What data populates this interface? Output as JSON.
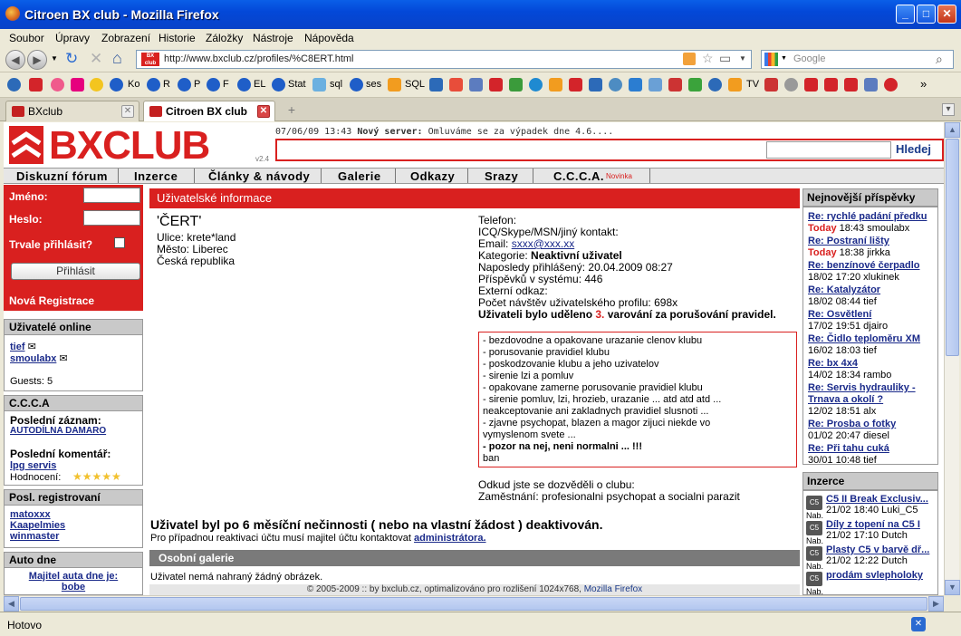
{
  "window": {
    "title": "Citroen BX club - Mozilla Firefox"
  },
  "menu": [
    "Soubor",
    "Úpravy",
    "Zobrazení",
    "Historie",
    "Záložky",
    "Nástroje",
    "Nápověda"
  ],
  "nav": {
    "url": "http://www.bxclub.cz/profiles/%C8ERT.html",
    "search_placeholder": "Google"
  },
  "bookmarks": [
    "Ko",
    "R",
    "P",
    "F",
    "EL",
    "Stat",
    "sql",
    "ses",
    "SQL",
    "TV"
  ],
  "tabs": [
    {
      "label": "BXclub"
    },
    {
      "label": "Citroen BX club"
    }
  ],
  "site": {
    "logo": "BXCLUB",
    "version": "v2.4",
    "news_date": "07/06/09 13:43",
    "news_title": "Nový server:",
    "news_text": "Omluváme se za výpadek dne 4.6....",
    "search_button": "Hledej",
    "nav": [
      "Diskuzní fórum",
      "Inzerce",
      "Články & návody",
      "Galerie",
      "Odkazy",
      "Srazy",
      "C.C.C.A."
    ],
    "nav_badge": "Novinka"
  },
  "login": {
    "name_label": "Jméno:",
    "pass_label": "Heslo:",
    "remember_label": "Trvale přihlásit?",
    "login_button": "Přihlásit",
    "register": "Nová Registrace"
  },
  "online": {
    "title": "Uživatelé online",
    "users": [
      "tief",
      "smoulabx"
    ],
    "guests": "Guests: 5"
  },
  "ccca": {
    "title": "C.C.C.A",
    "last_record_label": "Poslední záznam:",
    "last_record": "AUTODÍLNA DAMARO",
    "last_comment_label": "Poslední komentář:",
    "last_comment": "lpg servis",
    "rating_label": "Hodnocení:",
    "rating_stars": 5
  },
  "registered": {
    "title": "Posl. registrovaní",
    "users": [
      "matoxxx",
      "Kaapelmies",
      "winmaster"
    ]
  },
  "carday": {
    "title": "Auto dne",
    "owner_label": "Majitel auta dne je:",
    "owner": "bobe"
  },
  "profile": {
    "section_title": "Uživatelské informace",
    "name": "'ČERT'",
    "street": "Ulice: krete*land",
    "city": "Město: Liberec",
    "country": "Česká republika",
    "phone": "Telefon:",
    "icq": "ICQ/Skype/MSN/jiný kontakt:",
    "email_label": "Email:",
    "email": "sxxx@xxx.xx",
    "category_label": "Kategorie:",
    "category": "Neaktivní uživatel",
    "last_login": "Naposledy přihlášený: 20.04.2009 08:27",
    "posts": "Příspěvků v systému: 446",
    "external": "Externí odkaz:",
    "visits": "Počet návštěv uživatelského profilu: 698x",
    "warn_prefix": "Uživateli bylo uděleno",
    "warn_count": "3.",
    "warn_suffix": "varování za porušování pravidel.",
    "rules": [
      "- bezdovodne a opakovane urazanie clenov klubu",
      "- porusovanie pravidiel klubu",
      "- poskodzovanie klubu a jeho uzivatelov",
      "- sirenie lzi a pomluv",
      "- opakovane zamerne porusovanie pravidiel klubu",
      "- sirenie pomluv, lzi, hrozieb, urazanie ... atd atd atd ...",
      "neakceptovanie ani zakladnych pravidiel slusnoti ...",
      "- zjavne psychopat, blazen a magor zijuci niekde vo",
      "vymyslenom svete ..."
    ],
    "rules_bold": "- pozor na nej, neni normalni ... !!!",
    "rules_end": "ban",
    "source": "Odkud jste se dozvěděli o clubu:",
    "job": "Zaměstnání: profesionalni psychopat a socialni parazit",
    "deactivated": "Uživatel byl po 6 měsíční nečinnosti ( nebo na vlastní žádost ) deaktivován.",
    "reactivation": "Pro případnou reaktivaci účtu musí majitel účtu kontaktovat",
    "admin_link": "administrátora.",
    "gallery_title": "Osobní galerie",
    "gallery_empty": "Uživatel nemá nahraný žádný obrázek."
  },
  "footer": {
    "text": "© 2005-2009 :: by bxclub.cz, optimalizováno pro rozlišení 1024x768,",
    "link": "Mozilla Firefox"
  },
  "latest": {
    "title": "Nejnovější příspěvky",
    "items": [
      {
        "title": "Re: rychlé padání předku",
        "date": "Today",
        "time": "18:43",
        "user": "smoulabx"
      },
      {
        "title": "Re: Postraní lišty",
        "date": "Today",
        "time": "18:38",
        "user": "jirkka"
      },
      {
        "title": "Re: benzínové čerpadlo",
        "date": "18/02",
        "time": "17:20",
        "user": "xlukinek"
      },
      {
        "title": "Re: Katalyzátor",
        "date": "18/02",
        "time": "08:44",
        "user": "tief"
      },
      {
        "title": "Re: Osvětlení",
        "date": "17/02",
        "time": "19:51",
        "user": "djairo"
      },
      {
        "title": "Re: Čidlo teploměru XM",
        "date": "16/02",
        "time": "18:03",
        "user": "tief"
      },
      {
        "title": "Re: bx 4x4",
        "date": "14/02",
        "time": "18:34",
        "user": "rambo"
      },
      {
        "title": "Re: Servis hydrauliky - Trnava a okolí ?",
        "date": "12/02",
        "time": "18:51",
        "user": "alx"
      },
      {
        "title": "Re: Prosba o fotky",
        "date": "01/02",
        "time": "20:47",
        "user": "diesel"
      },
      {
        "title": "Re: Při tahu cuká",
        "date": "30/01",
        "time": "10:48",
        "user": "tief"
      }
    ]
  },
  "ads": {
    "title": "Inzerce",
    "badge": "Nab.",
    "items": [
      {
        "title": "C5 II Break Exclusiv...",
        "date": "21/02",
        "time": "18:40",
        "user": "Luki_C5"
      },
      {
        "title": "Díly z topení na C5 I",
        "date": "21/02",
        "time": "17:10",
        "user": "Dutch"
      },
      {
        "title": "Plasty C5 v barvě dř...",
        "date": "21/02",
        "time": "12:22",
        "user": "Dutch"
      },
      {
        "title": "prodám svlepholoky",
        "date": "",
        "time": "",
        "user": ""
      }
    ]
  },
  "status": {
    "text": "Hotovo"
  }
}
